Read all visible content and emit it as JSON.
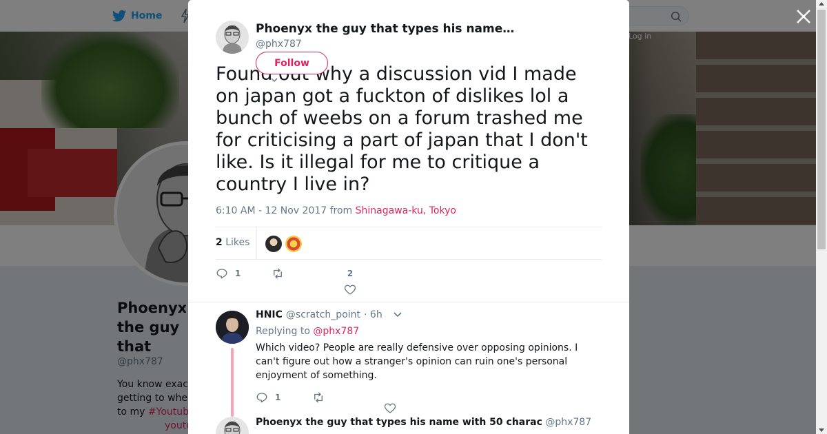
{
  "background": {
    "nav": {
      "home_label": "Home",
      "login_label": "Log in"
    },
    "profile": {
      "name": "Phoenyx the guy that types his name with 50 charac",
      "handle": "@phx787",
      "bio_lines": [
        "You know exac",
        "getting to whe",
        "to my"
      ],
      "bio_hashtag": "#Youtub",
      "bio_link": "youtu"
    }
  },
  "tweet": {
    "author_name": "Phoenyx the guy that types his name…",
    "author_handle": "@phx787",
    "follow_label": "Follow",
    "text": "Found out why a discussion vid I made on japan got a fuckton of dislikes lol a bunch of weebs on a forum trashed me for criticising a part of japan that I don't like. Is it illegal for me to critique a country I live in?",
    "timestamp": "6:10 AM - 12 Nov 2017 from",
    "location": "Shinagawa-ku, Tokyo",
    "likes_count": "2",
    "likes_label": "Likes",
    "reply_count": "1",
    "retweet_count": "",
    "like_count": "2"
  },
  "replies": [
    {
      "name": "HNIC",
      "handle": "@scratch_point",
      "time": "· 6h",
      "replying_prefix": "Replying to",
      "replying_to": "@phx787",
      "text": "Which video? People are really defensive over opposing opinions. I can't figure out how a stranger's opinion can ruin one's personal enjoyment of something.",
      "reply_count": "1"
    },
    {
      "name": "Phoenyx the guy that types his name with 50 charac",
      "handle": "@phx787"
    }
  ],
  "colors": {
    "accent": "#e0245e",
    "twitter_blue": "#1da1f2",
    "muted": "#657786"
  },
  "icons": [
    "twitter-bird-icon",
    "search-icon",
    "close-icon",
    "reply-icon",
    "retweet-icon",
    "heart-icon",
    "chevron-down-icon"
  ]
}
